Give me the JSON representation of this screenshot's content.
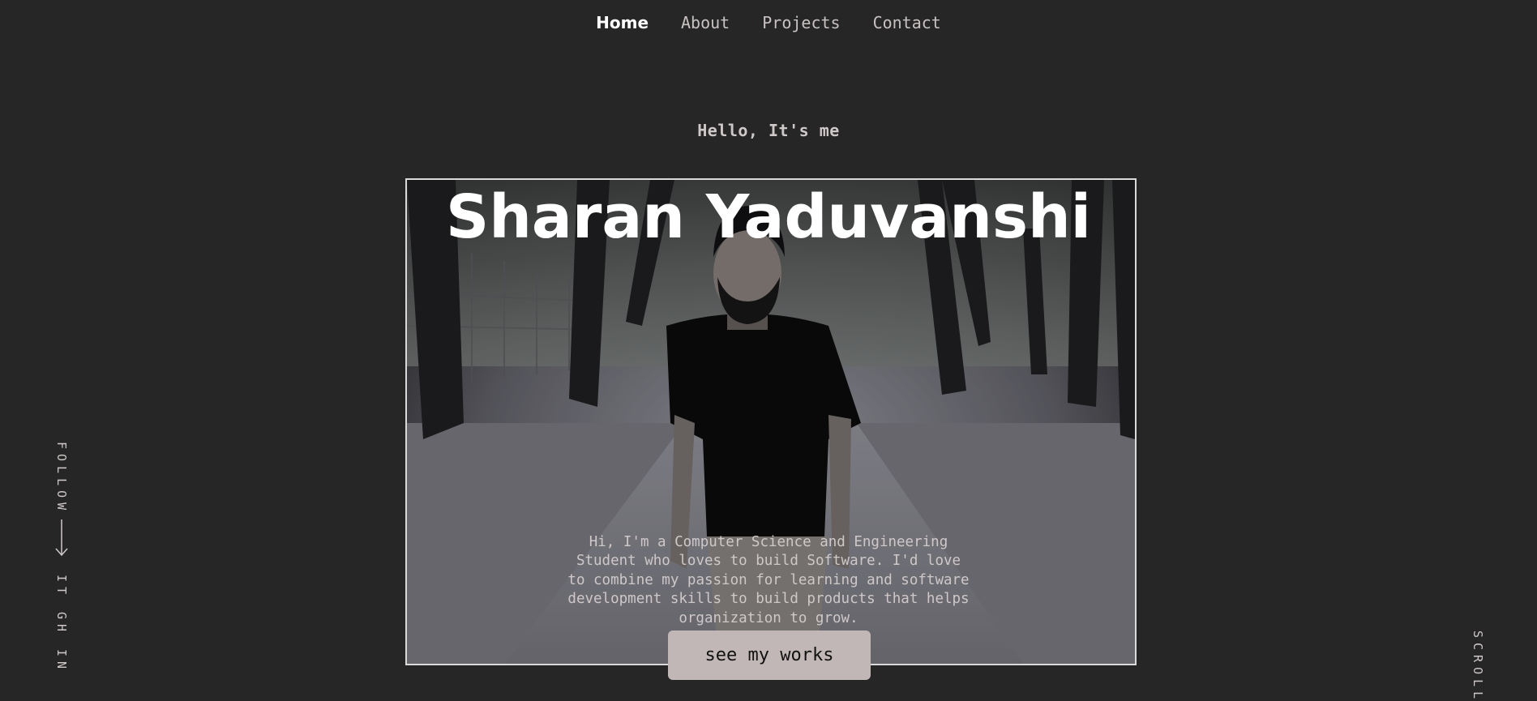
{
  "nav": {
    "items": [
      {
        "label": "Home",
        "active": true
      },
      {
        "label": "About",
        "active": false
      },
      {
        "label": "Projects",
        "active": false
      },
      {
        "label": "Contact",
        "active": false
      }
    ]
  },
  "hero": {
    "greeting": "Hello, It's me",
    "name": "Sharan Yaduvanshi",
    "bio": "Hi, I'm a Computer Science and Engineering Student who loves to build Software. I'd love to combine my passion for learning and software development skills to build products that helps organization to grow.",
    "cta_label": "see my works",
    "photo_icon": "portrait-photo"
  },
  "sidebar": {
    "follow_label": "FOLLOW",
    "socials": [
      "IT",
      "GH",
      "IN"
    ]
  },
  "scroll": {
    "label": "SCROLL"
  },
  "colors": {
    "background": "#262626",
    "accent_button": "#c2b7b7",
    "text_muted": "#cfc8c8",
    "text_white": "#ffffff"
  }
}
